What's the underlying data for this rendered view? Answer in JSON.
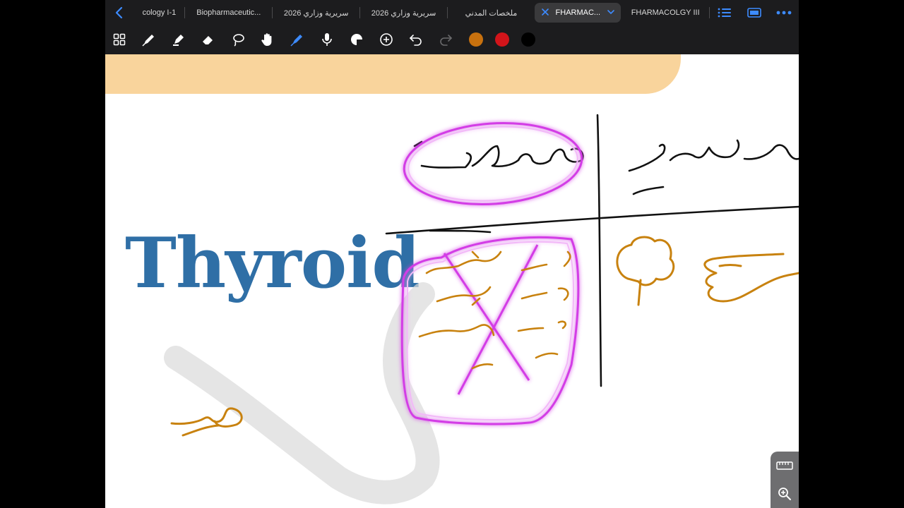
{
  "tabs": [
    {
      "label": "cology I-1"
    },
    {
      "label": "Biopharmaceutic..."
    },
    {
      "label": "سريرية وزاري 2026"
    },
    {
      "label": "سريرية وزاري 2026"
    },
    {
      "label": "ملخصات المدني"
    },
    {
      "label": "FHARMAC...",
      "active": true
    },
    {
      "label": "FHARMACOLGY III"
    }
  ],
  "toolbar": {
    "tools": [
      "grid-icon",
      "pen-icon",
      "highlighter-icon",
      "eraser-icon",
      "lasso-icon",
      "hand-icon",
      "laser-pointer-icon",
      "microphone-icon",
      "shapes-icon",
      "add-icon",
      "undo-icon",
      "redo-icon"
    ],
    "active_tool": "laser-pointer-icon",
    "colors": [
      "#c8710e",
      "#d2141a",
      "#000000"
    ]
  },
  "page": {
    "heading": "Thyroid",
    "heading_color": "#2f6fa6",
    "banner_color": "#f9d49c",
    "ink_black": "#111111",
    "ink_orange": "#c8820f",
    "lasso_glow": "#d33ee6"
  }
}
